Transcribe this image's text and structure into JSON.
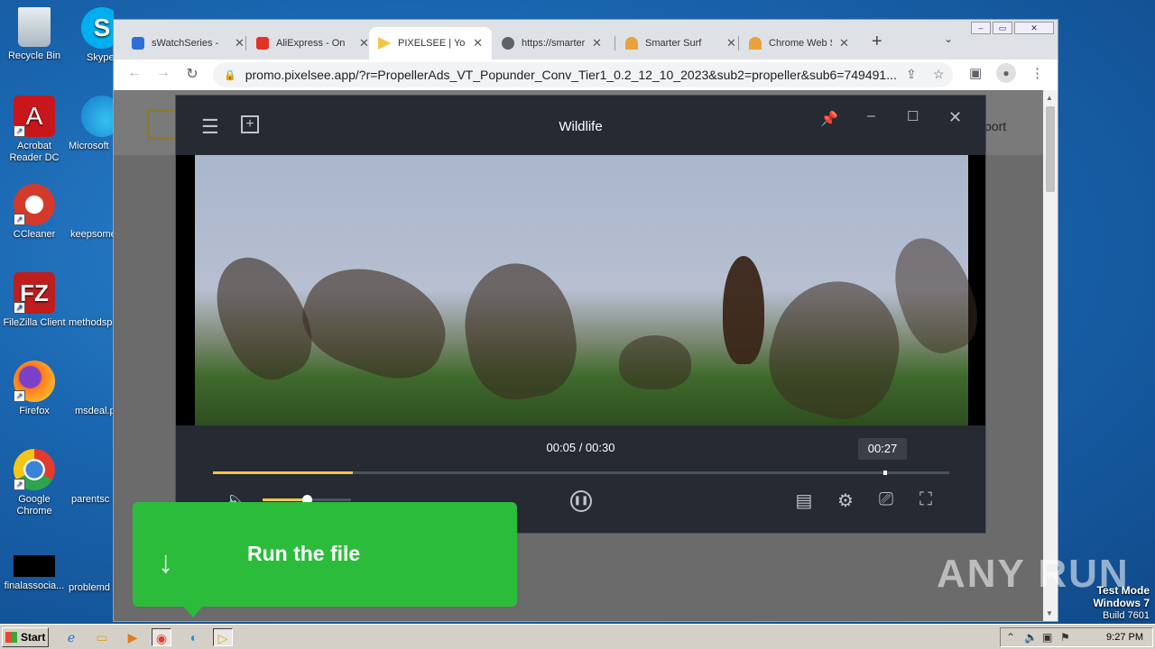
{
  "desktop": {
    "icons": [
      {
        "label": "Recycle Bin",
        "color": "#cfd8e0"
      },
      {
        "label": "Acrobat Reader DC",
        "color": "#c8161d"
      },
      {
        "label": "CCleaner",
        "color": "#d33a2b"
      },
      {
        "label": "FileZilla Client",
        "color": "#bf1e1e"
      },
      {
        "label": "Firefox",
        "color": "#ff7a1a"
      },
      {
        "label": "Google Chrome",
        "color": "#3b82d8"
      },
      {
        "label": "finalassocia...",
        "color": "#000000"
      }
    ],
    "icons_col2": [
      {
        "label": "Skype",
        "color": "#00aff0"
      },
      {
        "label": "Microsoft",
        "color": "#1f8fd6"
      },
      {
        "label": "keepsome",
        "color": "#1a66b0"
      },
      {
        "label": "methodsp",
        "color": "#1a66b0"
      },
      {
        "label": "msdeal.p",
        "color": "#1a66b0"
      },
      {
        "label": "parentsc",
        "color": "#1a66b0"
      },
      {
        "label": "problemd",
        "color": "#1a66b0"
      }
    ]
  },
  "browser": {
    "tabs": [
      {
        "label": "sWatchSeries -",
        "favicon": "#2d6fd6"
      },
      {
        "label": "AliExpress - On",
        "favicon": "#e43226"
      },
      {
        "label": "PIXELSEE | You",
        "favicon": "#f6c445"
      },
      {
        "label": "https://smarter",
        "favicon": "#5f6368"
      },
      {
        "label": "Smarter Surf",
        "favicon": "#e9a23b"
      },
      {
        "label": "Chrome Web S",
        "favicon": "#e9a23b"
      }
    ],
    "url": "promo.pixelsee.app/?r=PropellerAds_VT_Popunder_Conv_Tier1_0.2_12_10_2023&sub2=propeller&sub6=749491...",
    "page": {
      "support_label": "port"
    }
  },
  "player": {
    "title": "Wildlife",
    "time_display": "00:05 / 00:30",
    "hover_time": "00:27",
    "progress_fraction": 0.19,
    "hover_fraction": 0.91,
    "volume_fraction": 0.5,
    "accent": "#f6c445"
  },
  "banner": {
    "label": "Run the file",
    "color": "#2cbc3c"
  },
  "watermark": "ANY RUN",
  "testmode": {
    "line1": "Test Mode",
    "line2": "Windows 7",
    "line3": "Build 7601"
  },
  "taskbar": {
    "start_label": "Start",
    "clock": "9:27 PM"
  }
}
